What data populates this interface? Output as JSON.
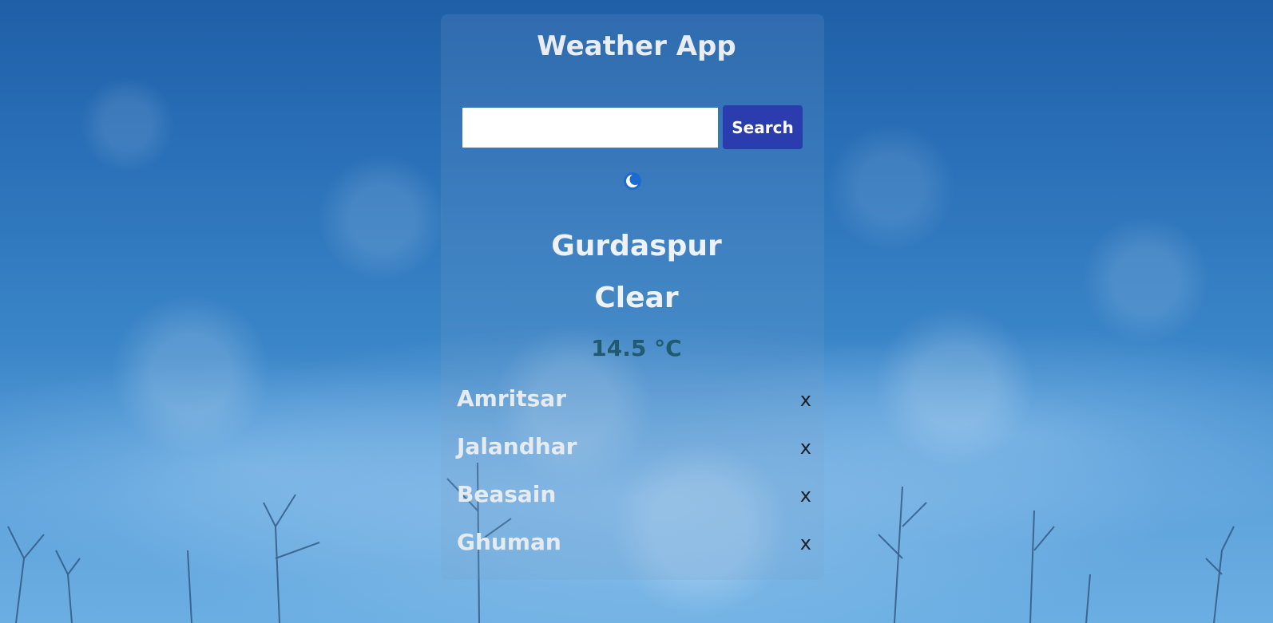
{
  "app": {
    "title": "Weather App"
  },
  "search": {
    "value": "",
    "placeholder": "",
    "button_label": "Search"
  },
  "current": {
    "icon": "moon-icon",
    "city": "Gurdaspur",
    "condition": "Clear",
    "temperature": "14.5 °C"
  },
  "saved_cities": [
    {
      "name": "Amritsar",
      "remove_label": "x"
    },
    {
      "name": "Jalandhar",
      "remove_label": "x"
    },
    {
      "name": "Beasain",
      "remove_label": "x"
    },
    {
      "name": "Ghuman",
      "remove_label": "x"
    }
  ],
  "colors": {
    "button_bg": "#2a3cae",
    "temperature_text": "#1f5a6e",
    "sky": "#2a70b8"
  }
}
